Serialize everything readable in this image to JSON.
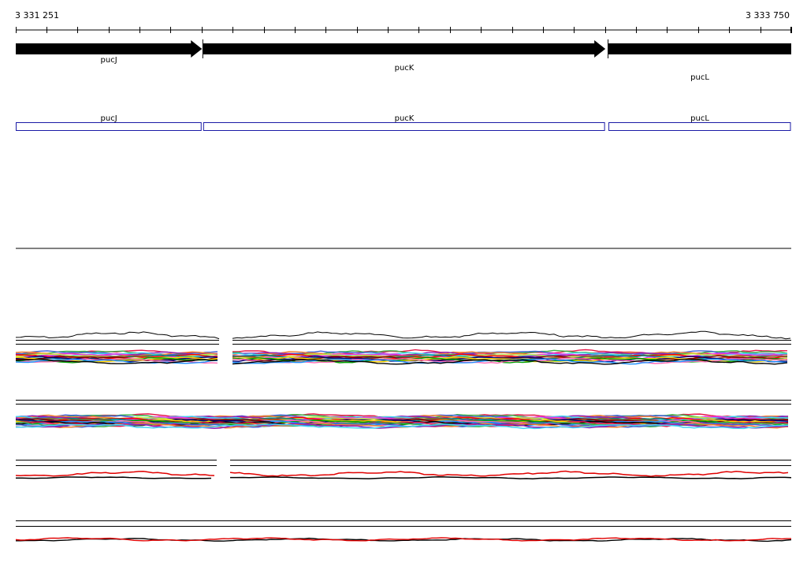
{
  "ruler": {
    "start_label": "3 331 251",
    "end_label": "3 333 750",
    "start": 3331251,
    "end": 3333750,
    "tick_interval": 100
  },
  "genes": [
    {
      "name": "pucJ",
      "start": 3331251,
      "end": 3331851,
      "strand": "+"
    },
    {
      "name": "pucK",
      "start": 3331855,
      "end": 3333151,
      "strand": "+"
    },
    {
      "name": "pucL",
      "start": 3333161,
      "end": 3333750,
      "strand": "+"
    }
  ],
  "colors": {
    "gene_arrow": "#000000",
    "feature_box": "#1a1aa6",
    "line_primary": "#e00000",
    "line_secondary": "#000000",
    "palette": [
      "#e6194b",
      "#3cb44b",
      "#4363d8",
      "#f58231",
      "#911eb4",
      "#42d4f4",
      "#f032e6",
      "#bfef45",
      "#ff0000",
      "#008080",
      "#9a6324",
      "#800000",
      "#000075",
      "#ffd700",
      "#00a000",
      "#ff69b4",
      "#1e90ff",
      "#000000"
    ]
  }
}
